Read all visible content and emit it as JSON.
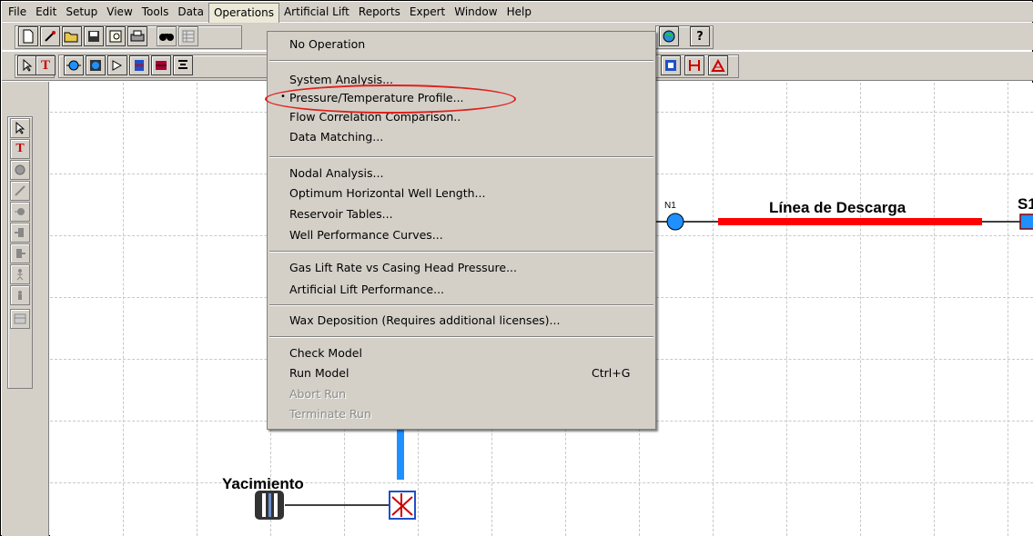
{
  "menubar": {
    "items": [
      "File",
      "Edit",
      "Setup",
      "View",
      "Tools",
      "Data",
      "Operations",
      "Artificial Lift",
      "Reports",
      "Expert",
      "Window",
      "Help"
    ],
    "active": "Operations"
  },
  "operations_menu": {
    "items": [
      {
        "label": "No Operation",
        "enabled": true
      },
      {
        "label": "System Analysis...",
        "enabled": true
      },
      {
        "label": "Pressure/Temperature Profile...",
        "enabled": true,
        "selected": true
      },
      {
        "label": "Flow Correlation Comparison..",
        "enabled": true
      },
      {
        "label": "Data Matching...",
        "enabled": true
      },
      {
        "label": "Nodal Analysis...",
        "enabled": true
      },
      {
        "label": "Optimum Horizontal Well Length...",
        "enabled": true
      },
      {
        "label": "Reservoir Tables...",
        "enabled": true
      },
      {
        "label": "Well Performance Curves...",
        "enabled": true
      },
      {
        "label": "Gas Lift Rate vs Casing Head Pressure...",
        "enabled": true
      },
      {
        "label": "Artificial Lift Performance...",
        "enabled": true
      },
      {
        "label": "Wax Deposition (Requires additional licenses)...",
        "enabled": true
      },
      {
        "label": "Check Model",
        "enabled": true
      },
      {
        "label": "Run Model",
        "enabled": true,
        "shortcut": "Ctrl+G"
      },
      {
        "label": "Abort Run",
        "enabled": false
      },
      {
        "label": "Terminate Run",
        "enabled": false
      }
    ],
    "bullet": "•",
    "highlight_color": "#e0201c"
  },
  "toolbar1": {
    "icons": [
      "new-file-icon",
      "wand-icon",
      "open-folder-icon",
      "save-icon",
      "print-preview-icon",
      "print-icon",
      "binoculars-icon",
      "grid-icon",
      "globe-icon",
      "help-icon"
    ],
    "help_glyph": "?"
  },
  "toolbar2": {
    "icons": [
      "pointer-icon",
      "text-tool-icon",
      "source-icon",
      "sink-icon",
      "junction-icon",
      "flowline-icon",
      "choke-icon",
      "pump-icon",
      "report-icon",
      "marker-icon",
      "chart-icon"
    ],
    "text_glyph": "T"
  },
  "canvas": {
    "node_n1_label": "N1",
    "flowline_label": "Línea de Descarga",
    "sink_label": "S1",
    "reservoir_label": "Yacimiento",
    "colors": {
      "flowline": "#ff0000",
      "node": "#1e90ff",
      "riser": "#1e90ff"
    }
  }
}
